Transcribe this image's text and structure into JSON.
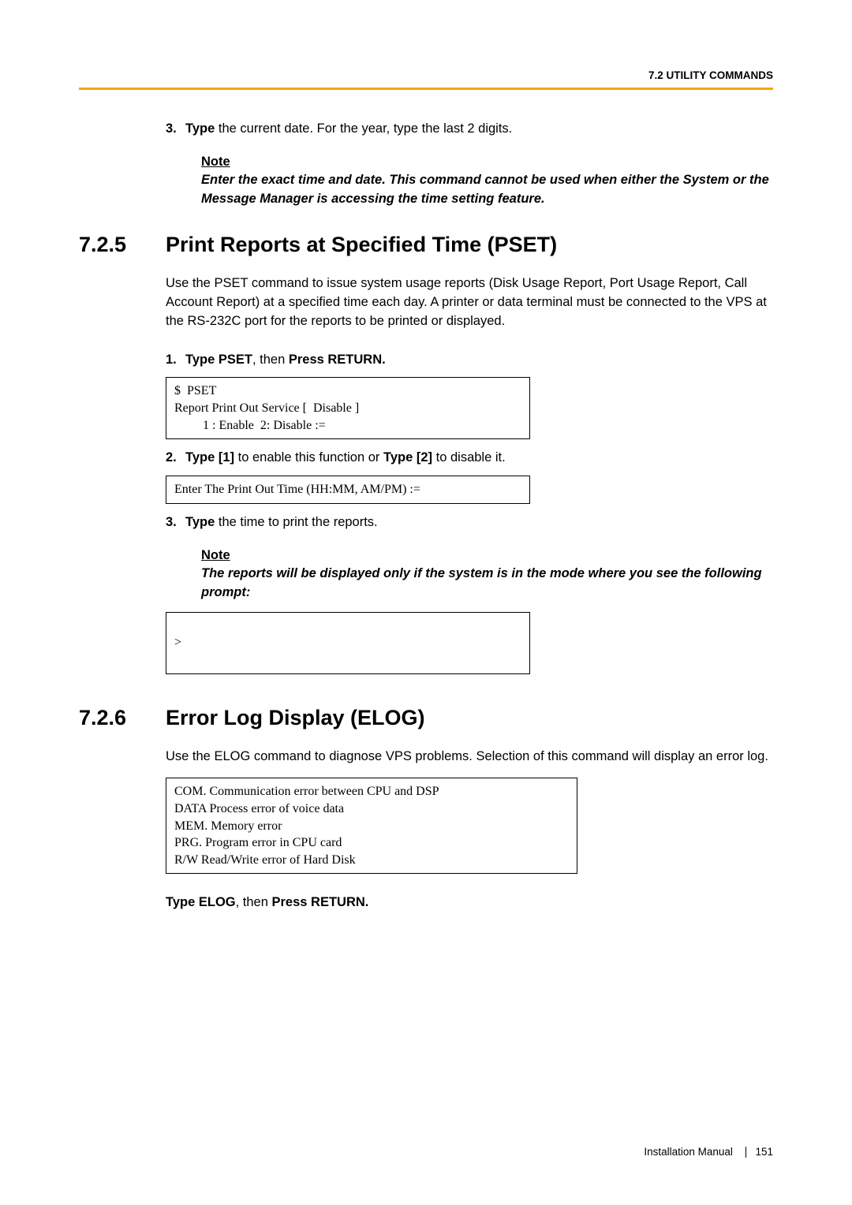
{
  "header": {
    "section_label": "7.2 UTILITY COMMANDS"
  },
  "step3_top": {
    "num": "3.",
    "lead": "Type",
    "rest": " the current date. For the year, type the last 2 digits."
  },
  "note_top": {
    "heading": "Note",
    "text": "Enter the exact time and date. This command cannot be used when either the System or the Message Manager is accessing the time setting feature."
  },
  "sec725": {
    "num": "7.2.5",
    "title": "Print Reports at Specified Time (PSET)",
    "intro": "Use the PSET command to issue system usage reports (Disk Usage Report, Port Usage Report, Call Account Report) at a specified time each day. A printer or data terminal must be connected to the VPS at the RS-232C port for the reports to be printed or displayed.",
    "step1": {
      "num": "1.",
      "part_a": "Type PSET",
      "mid": ", then ",
      "part_b": "Press RETURN."
    },
    "code1": "$  PSET\nReport Print Out Service [  Disable ]\n         1 : Enable  2: Disable :=",
    "step2": {
      "num": "2.",
      "a": "Type [1]",
      "b": " to enable this function or ",
      "c": "Type [2]",
      "d": " to disable it."
    },
    "code2": "Enter The Print Out Time (HH:MM, AM/PM) :=",
    "step3": {
      "num": "3.",
      "a": "Type",
      "b": " the time to print the reports."
    },
    "note": {
      "heading": "Note",
      "text": "The reports will be displayed only if the system is in the mode where you see the following prompt:"
    },
    "code3": ">"
  },
  "sec726": {
    "num": "7.2.6",
    "title": "Error Log Display (ELOG)",
    "intro": "Use the ELOG command to diagnose VPS problems. Selection of this command will display an error log.",
    "code": "COM. Communication error between CPU and DSP\nDATA Process error of voice data\nMEM. Memory error\nPRG. Program error in CPU card\nR/W Read/Write error of Hard Disk",
    "step": {
      "a": "Type ELOG",
      "mid": ", then ",
      "b": "Press RETURN."
    }
  },
  "footer": {
    "label": "Installation Manual",
    "page": "151"
  }
}
